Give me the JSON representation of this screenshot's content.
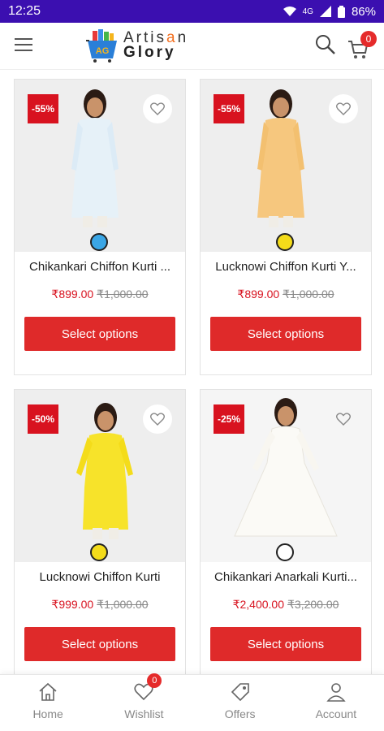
{
  "status_bar": {
    "time": "12:25",
    "battery": "86%",
    "network": "4G"
  },
  "header": {
    "logo_line1_a": "Artis",
    "logo_line1_b": "a",
    "logo_line1_c": "n",
    "logo_line2": "Glory",
    "logo_badge": "AG",
    "cart_count": "0"
  },
  "products": [
    {
      "title": "Chikankari Chiffon Kurti ...",
      "price": "₹899.00",
      "regular": "₹1,000.00",
      "discount": "-55%",
      "swatch": "#3aa6e6",
      "button": "Select options"
    },
    {
      "title": "Lucknowi Chiffon Kurti Y...",
      "price": "₹899.00",
      "regular": "₹1,000.00",
      "discount": "-55%",
      "swatch": "#f4dc1a",
      "button": "Select options"
    },
    {
      "title": "Lucknowi Chiffon Kurti",
      "price": "₹999.00",
      "regular": "₹1,000.00",
      "discount": "-50%",
      "swatch": "#f4dc1a",
      "button": "Select options"
    },
    {
      "title": "Chikankari Anarkali Kurti...",
      "price": "₹2,400.00",
      "regular": "₹3,200.00",
      "discount": "-25%",
      "swatch": "#ffffff",
      "button": "Select options"
    }
  ],
  "bottom_nav": [
    {
      "label": "Home",
      "icon": "home-icon"
    },
    {
      "label": "Wishlist",
      "icon": "heart-icon",
      "badge": "0"
    },
    {
      "label": "Offers",
      "icon": "tag-icon"
    },
    {
      "label": "Account",
      "icon": "user-icon"
    }
  ],
  "colors": {
    "status_bar": "#3b0fb0",
    "accent": "#df2a2a",
    "logo_accent": "#f37021"
  }
}
